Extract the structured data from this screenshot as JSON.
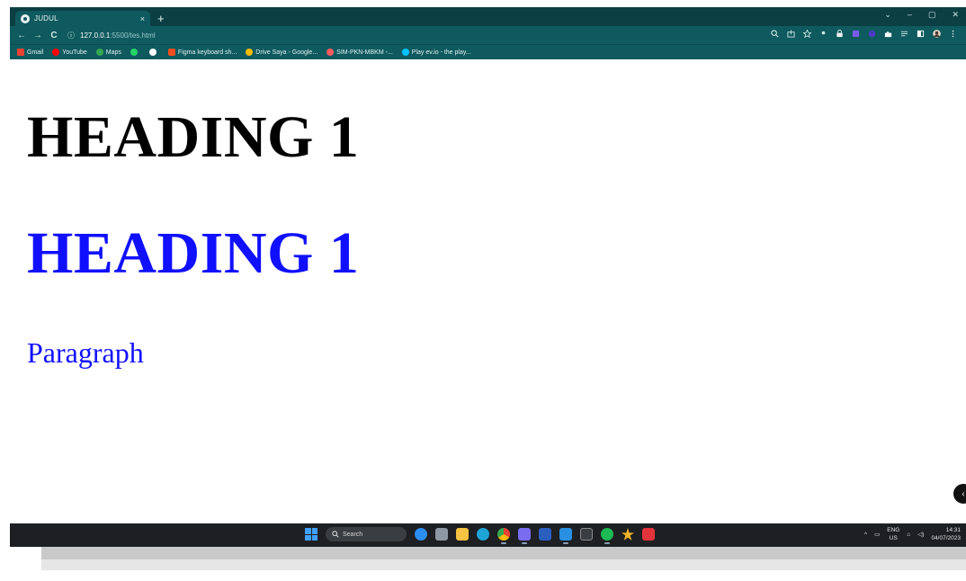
{
  "browser": {
    "tab_title": "JUDUL",
    "tab_close": "×",
    "new_tab": "+",
    "window_controls": [
      "⌄",
      "–",
      "▢",
      "✕"
    ],
    "url_host": "127.0.0.1",
    "url_path": ":5500/tes.html",
    "nav": {
      "back": "←",
      "forward": "→",
      "reload": "C",
      "info": "ⓘ"
    }
  },
  "bookmarks": [
    {
      "label": "Gmail",
      "color": "#ea4335"
    },
    {
      "label": "YouTube",
      "color": "#ff0000"
    },
    {
      "label": "Maps",
      "color": "#34a853"
    },
    {
      "label": "",
      "color": "#25d366"
    },
    {
      "label": "",
      "color": "#ffffff"
    },
    {
      "label": "Figma keyboard sh...",
      "color": "#f24e1e"
    },
    {
      "label": "Drive Saya - Google...",
      "color": "#fbbc04"
    },
    {
      "label": "SIM-PKN-MBKM -...",
      "color": "#ff5a5f"
    },
    {
      "label": "Play ev.io - the play...",
      "color": "#00c2ff"
    }
  ],
  "page": {
    "heading_black": "HEADING 1",
    "heading_blue": "HEADING 1",
    "paragraph": "Paragraph"
  },
  "taskbar": {
    "search_label": "Search",
    "tray": {
      "lang_top": "ENG",
      "lang_bottom": "US",
      "time": "14:31",
      "date": "04/07/2023"
    }
  },
  "colors": {
    "heading_black": "#000000",
    "heading_blue": "#1010ff",
    "browser_dark": "#0b3f44",
    "browser_teal": "#0f5a5f",
    "taskbar": "#1d1f22"
  }
}
